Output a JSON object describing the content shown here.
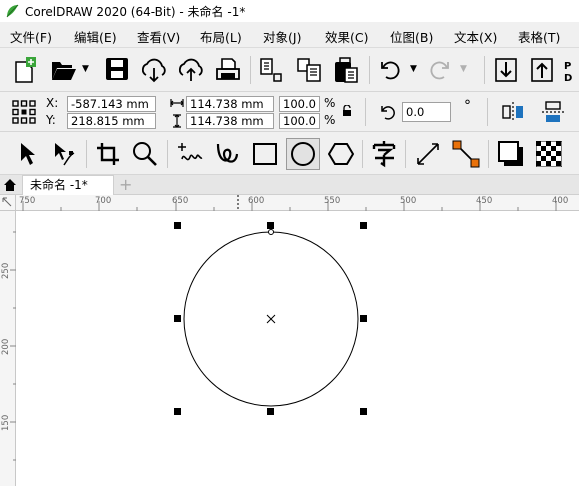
{
  "window": {
    "title": "CorelDRAW 2020 (64-Bit) - 未命名 -1*"
  },
  "menu": [
    "文件(F)",
    "编辑(E)",
    "查看(V)",
    "布局(L)",
    "对象(J)",
    "效果(C)",
    "位图(B)",
    "文本(X)",
    "表格(T)"
  ],
  "property_bar": {
    "x_label": "X:",
    "x_value": "-587.143 mm",
    "y_label": "Y:",
    "y_value": "218.815 mm",
    "width_value": "114.738 mm",
    "height_value": "114.738 mm",
    "scale_w": "100.0",
    "scale_h": "100.0",
    "percent": "%",
    "rotation": "0.0",
    "degree": "°"
  },
  "tab": {
    "label": "未命名 -1*",
    "add": "+"
  },
  "ruler": {
    "h_labels": [
      "750",
      "700",
      "650",
      "600",
      "550",
      "500",
      "450",
      "400"
    ],
    "v_labels": [
      "250",
      "200",
      "150"
    ]
  },
  "colors": {
    "accent": "#1e73be",
    "toolbar_bg": "#f0f0f0",
    "canvas": "#ffffff"
  }
}
